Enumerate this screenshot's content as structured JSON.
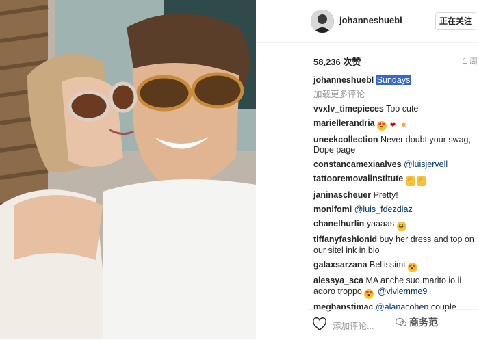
{
  "post": {
    "author": "johanneshuebl",
    "follow_label": "正在关注",
    "likes": "58,236 次赞",
    "time": "1 周",
    "caption_user": "johanneshuebl",
    "caption_text": "Sundays",
    "load_more": "加载更多评论"
  },
  "comments": [
    {
      "user": "vvxlv_timepieces",
      "text": "Too cute"
    },
    {
      "user": "mariellerandria",
      "text": ""
    },
    {
      "user": "uneekcollection",
      "text": "Never doubt your swag, Dope page"
    },
    {
      "user": "constancamexiaalves",
      "text": "",
      "mention": "@luisjervell"
    },
    {
      "user": "tattooremovalinstitute",
      "text": ""
    },
    {
      "user": "janinascheuer",
      "text": "Pretty!"
    },
    {
      "user": "monifomi",
      "text": "",
      "mention": "@luis_fdezdiaz"
    },
    {
      "user": "chanelhurlin",
      "text": "yaaaas"
    },
    {
      "user": "tiffanyfashionid",
      "text": "buy her dress and top on our sitel ink in bio"
    },
    {
      "user": "galaxsarzana",
      "text": "Bellissimi"
    },
    {
      "user": "alessya_sca",
      "text": "MA anche suo marito io li adoro troppo",
      "mention": "@viviemme9"
    },
    {
      "user": "meghanstimac",
      "text": "couple",
      "mention": "@alanacohen"
    }
  ],
  "footer": {
    "add_comment_placeholder": "添加评论...",
    "watermark": "商务范"
  },
  "icons": {
    "heart": "heart-icon",
    "watermark": "wechat-icon"
  }
}
